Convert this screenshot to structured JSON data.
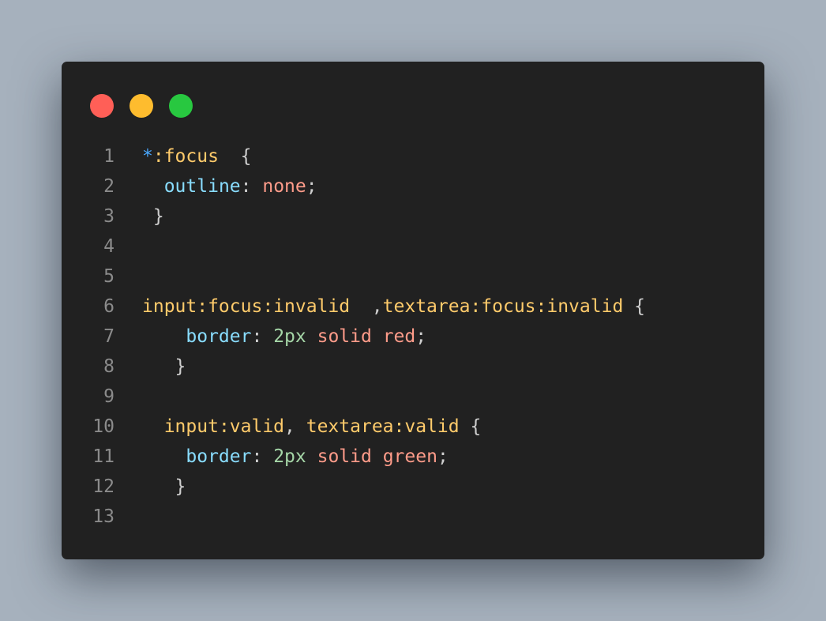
{
  "window_dots": [
    {
      "name": "close",
      "color": "#ff5f57"
    },
    {
      "name": "minimize",
      "color": "#febc2e"
    },
    {
      "name": "maximize",
      "color": "#28c840"
    }
  ],
  "code": {
    "lines": [
      {
        "n": "1",
        "tokens": [
          {
            "t": "*",
            "c": "star"
          },
          {
            "t": ":focus",
            "c": "sel"
          },
          {
            "t": "  {",
            "c": "punc"
          }
        ]
      },
      {
        "n": "2",
        "tokens": [
          {
            "t": "  ",
            "c": "punc"
          },
          {
            "t": "outline",
            "c": "prop"
          },
          {
            "t": ": ",
            "c": "punc"
          },
          {
            "t": "none",
            "c": "val2"
          },
          {
            "t": ";",
            "c": "punc"
          }
        ]
      },
      {
        "n": "3",
        "tokens": [
          {
            "t": " }",
            "c": "punc"
          }
        ]
      },
      {
        "n": "4",
        "tokens": []
      },
      {
        "n": "5",
        "tokens": []
      },
      {
        "n": "6",
        "tokens": [
          {
            "t": "input:focus:invalid",
            "c": "sel"
          },
          {
            "t": "  ,",
            "c": "punc"
          },
          {
            "t": "textarea:focus:invalid",
            "c": "sel"
          },
          {
            "t": " {",
            "c": "punc"
          }
        ]
      },
      {
        "n": "7",
        "tokens": [
          {
            "t": "    ",
            "c": "punc"
          },
          {
            "t": "border",
            "c": "prop"
          },
          {
            "t": ": ",
            "c": "punc"
          },
          {
            "t": "2px",
            "c": "num"
          },
          {
            "t": " ",
            "c": "punc"
          },
          {
            "t": "solid",
            "c": "val2"
          },
          {
            "t": " ",
            "c": "punc"
          },
          {
            "t": "red",
            "c": "val2"
          },
          {
            "t": ";",
            "c": "punc"
          }
        ]
      },
      {
        "n": "8",
        "tokens": [
          {
            "t": "   }",
            "c": "punc"
          }
        ]
      },
      {
        "n": "9",
        "tokens": []
      },
      {
        "n": "10",
        "tokens": [
          {
            "t": "  ",
            "c": "punc"
          },
          {
            "t": "input:valid",
            "c": "sel"
          },
          {
            "t": ", ",
            "c": "punc"
          },
          {
            "t": "textarea:valid",
            "c": "sel"
          },
          {
            "t": " {",
            "c": "punc"
          }
        ]
      },
      {
        "n": "11",
        "tokens": [
          {
            "t": "    ",
            "c": "punc"
          },
          {
            "t": "border",
            "c": "prop"
          },
          {
            "t": ": ",
            "c": "punc"
          },
          {
            "t": "2px",
            "c": "num"
          },
          {
            "t": " ",
            "c": "punc"
          },
          {
            "t": "solid",
            "c": "val2"
          },
          {
            "t": " ",
            "c": "punc"
          },
          {
            "t": "green",
            "c": "val2"
          },
          {
            "t": ";",
            "c": "punc"
          }
        ]
      },
      {
        "n": "12",
        "tokens": [
          {
            "t": "   }",
            "c": "punc"
          }
        ]
      },
      {
        "n": "13",
        "tokens": []
      }
    ]
  }
}
